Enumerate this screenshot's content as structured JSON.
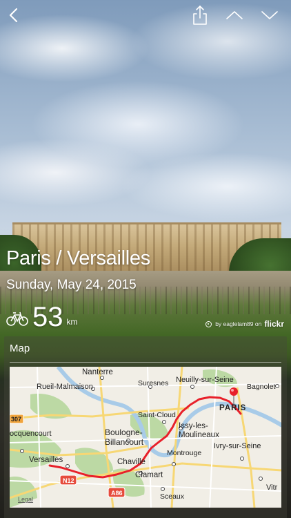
{
  "nav": {
    "back_icon": "chevron-left-icon",
    "share_icon": "share-icon",
    "prev_icon": "chevron-up-icon",
    "next_icon": "chevron-down-icon"
  },
  "ride": {
    "title": "Paris / Versailles",
    "date": "Sunday, May 24, 2015",
    "distance": "53",
    "unit": "km",
    "activity_icon": "bicycle-icon"
  },
  "photo_credit": {
    "text": "by eaglelam89 on",
    "source": "flickr"
  },
  "map": {
    "section_label": "Map",
    "legal": "Legal",
    "places": {
      "nanterre": "Nanterre",
      "rueil": "Rueil-Malmaison",
      "suresnes": "Suresnes",
      "neuilly": "Neuilly-sur-Seine",
      "bagnolet": "Bagnolet",
      "paris": "PARIS",
      "saint_cloud": "Saint-Cloud",
      "boulogne1": "Boulogne-",
      "boulogne2": "Billancourt",
      "issy1": "Issy-les-",
      "issy2": "Moulineaux",
      "rocquencourt": "ocquencourt",
      "versailles": "Versailles",
      "chaville": "Chaville",
      "clamart": "Clamart",
      "montrouge": "Montrouge",
      "ivry": "Ivry-sur-Seine",
      "sceaux": "Sceaux",
      "vitry": "Vitr"
    },
    "roads": {
      "n307": "307",
      "n12": "N12",
      "a86": "A86"
    },
    "route_color": "#e8202a",
    "pin_color": "#e8202a"
  }
}
